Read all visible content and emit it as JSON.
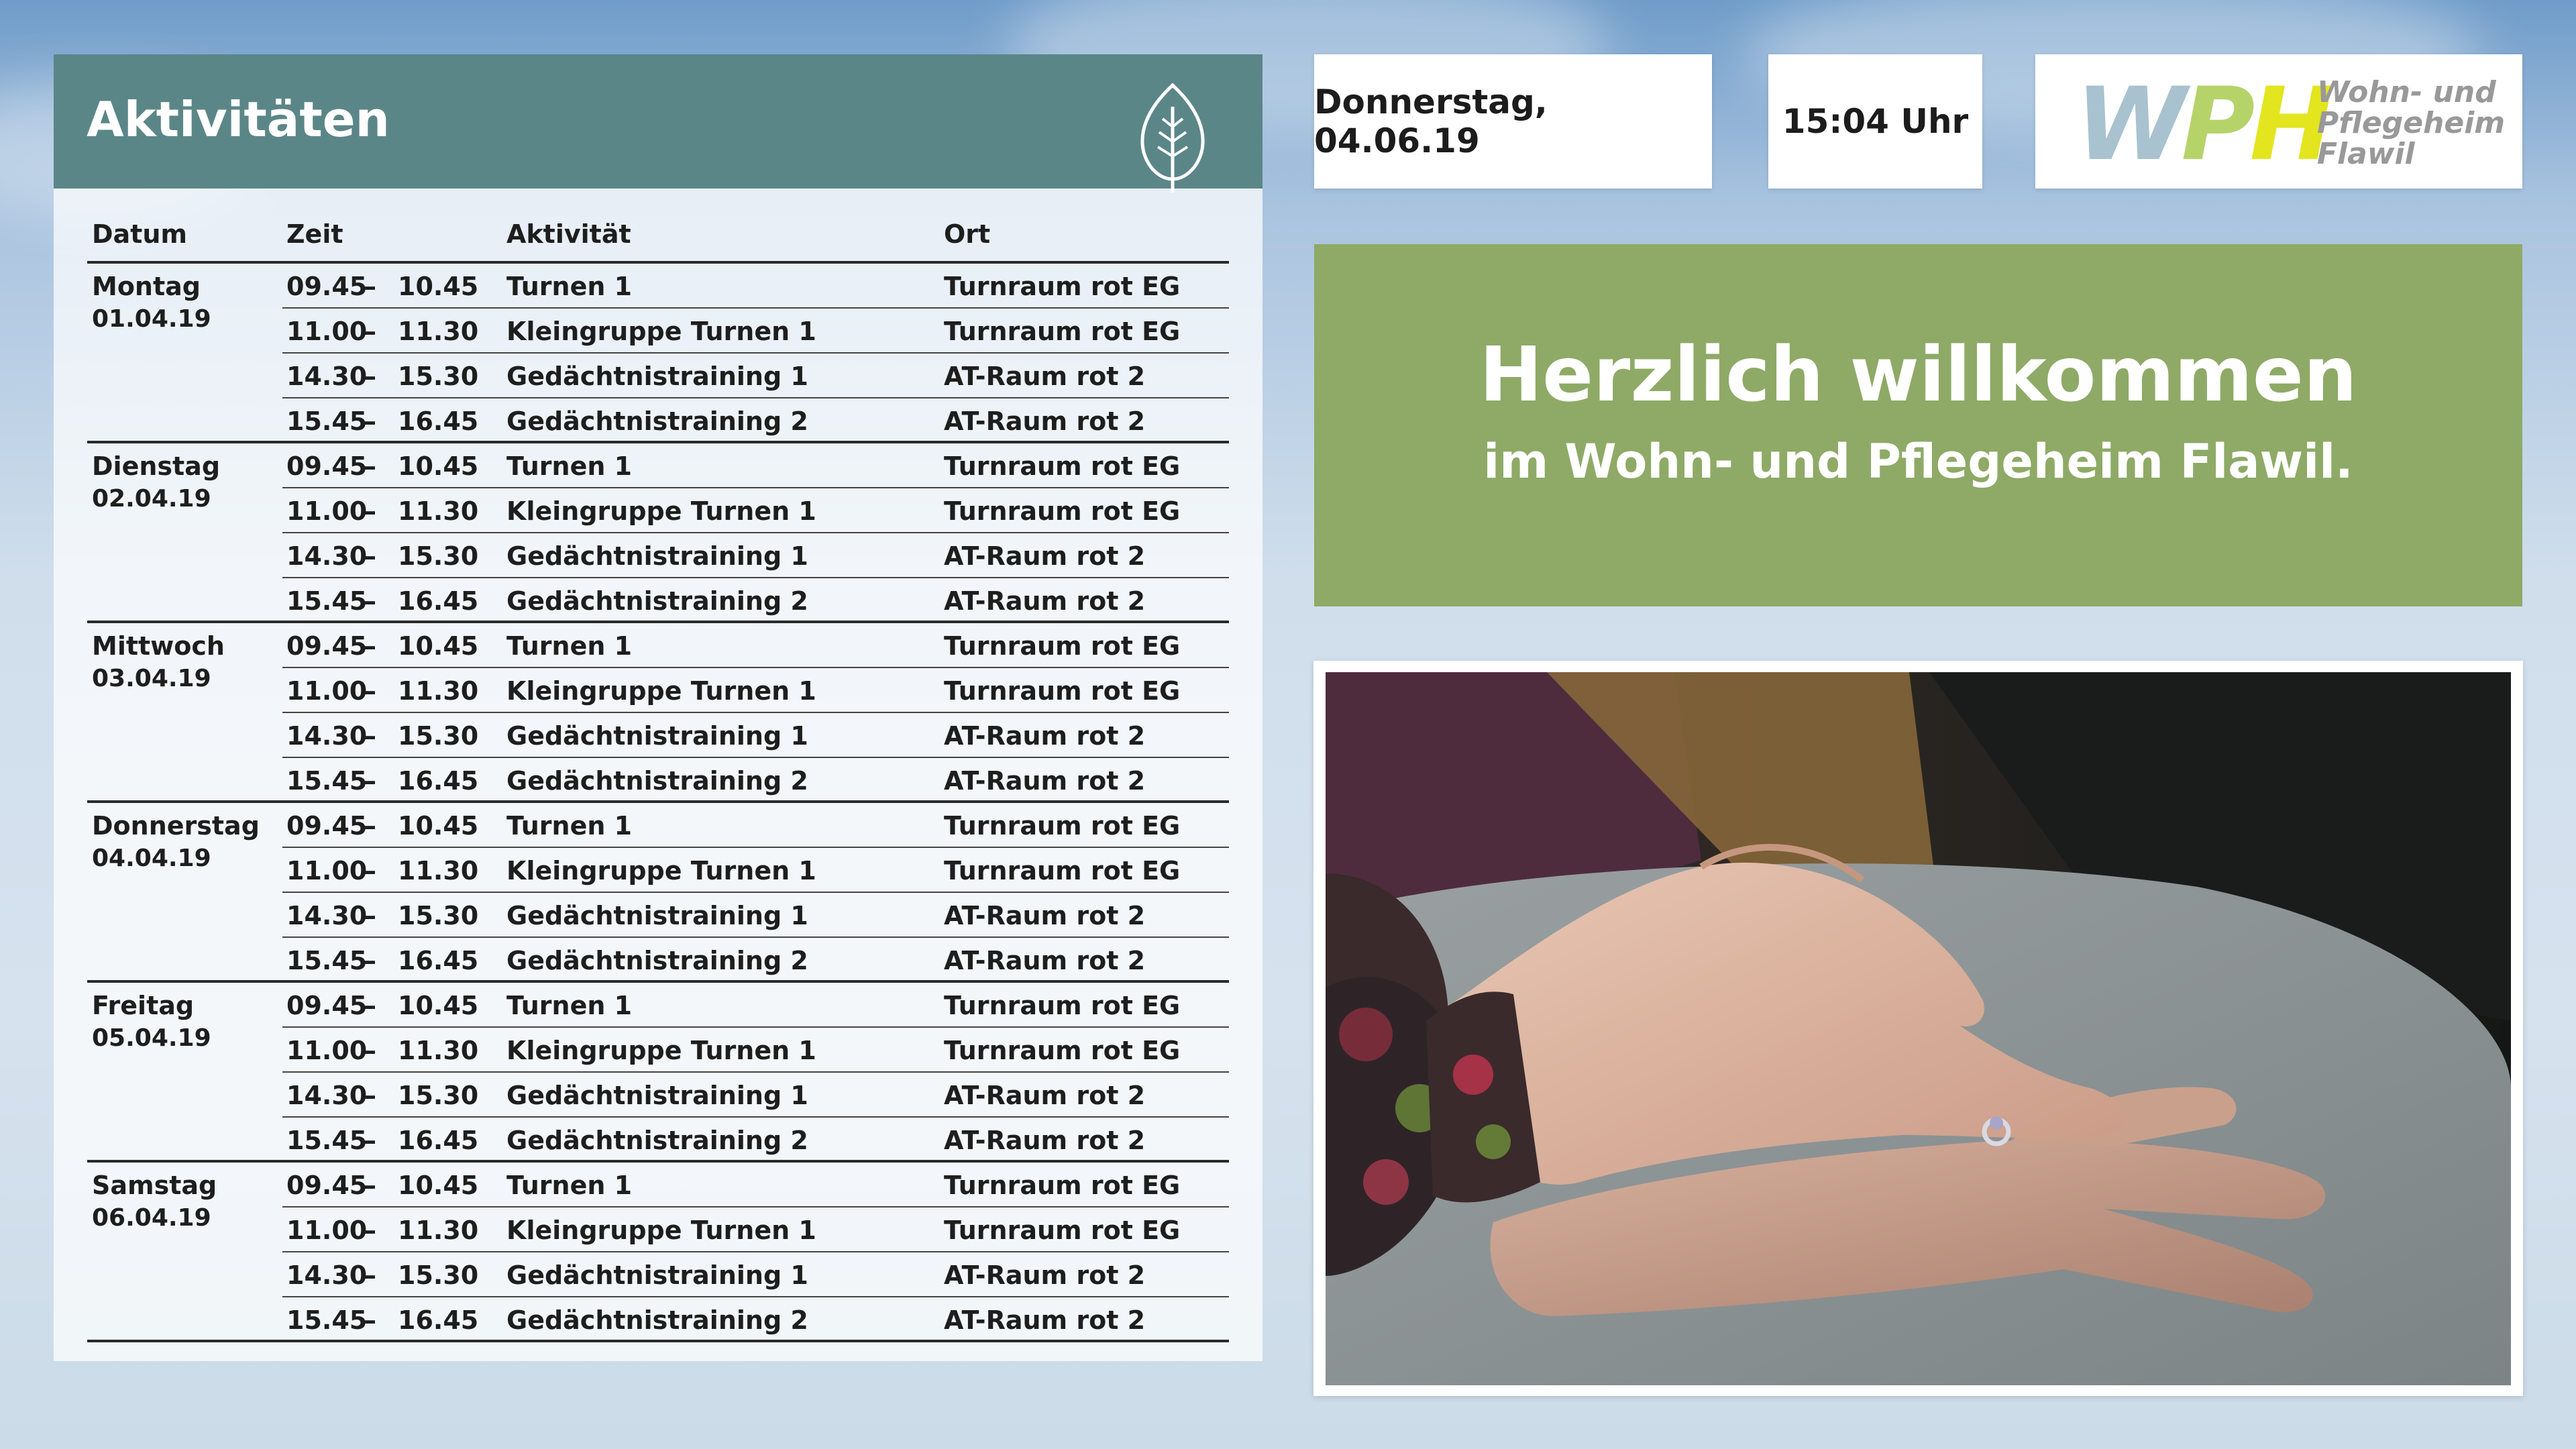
{
  "activities_panel": {
    "title": "Aktivitäten",
    "headers": {
      "date": "Datum",
      "time": "Zeit",
      "activity": "Aktivität",
      "place": "Ort"
    },
    "days": [
      {
        "name": "Montag",
        "date": "01.04.19"
      },
      {
        "name": "Dienstag",
        "date": "02.04.19"
      },
      {
        "name": "Mittwoch",
        "date": "03.04.19"
      },
      {
        "name": "Donnerstag",
        "date": "04.04.19"
      },
      {
        "name": "Freitag",
        "date": "05.04.19"
      },
      {
        "name": "Samstag",
        "date": "06.04.19"
      }
    ],
    "sessions": [
      {
        "start": "09.45",
        "dash": "–",
        "end": "10.45",
        "activity": "Turnen 1",
        "place": "Turnraum rot EG"
      },
      {
        "start": "11.00",
        "dash": "–",
        "end": "11.30",
        "activity": "Kleingruppe Turnen 1",
        "place": "Turnraum rot EG"
      },
      {
        "start": "14.30",
        "dash": "–",
        "end": "15.30",
        "activity": "Gedächtnistraining 1",
        "place": "AT-Raum rot 2"
      },
      {
        "start": "15.45",
        "dash": "–",
        "end": "16.45",
        "activity": "Gedächtnistraining 2",
        "place": "AT-Raum rot 2"
      }
    ]
  },
  "header": {
    "date": "Donnerstag, 04.06.19",
    "time": "15:04 Uhr"
  },
  "logo": {
    "letters": [
      "W",
      "P",
      "H"
    ],
    "lines": [
      "Wohn- und",
      "Pflegeheim",
      "Flawil"
    ]
  },
  "welcome": {
    "title": "Herzlich willkommen",
    "subtitle": "im Wohn- und Pflegeheim Flawil."
  },
  "colors": {
    "panel_header": "#5b8687",
    "welcome_bg": "#8eaa66",
    "logo_w": "#a8c2cf",
    "logo_p": "#b6d36a",
    "logo_h": "#e3e51f"
  },
  "icons": {
    "panel_icon": "leaf-icon"
  }
}
